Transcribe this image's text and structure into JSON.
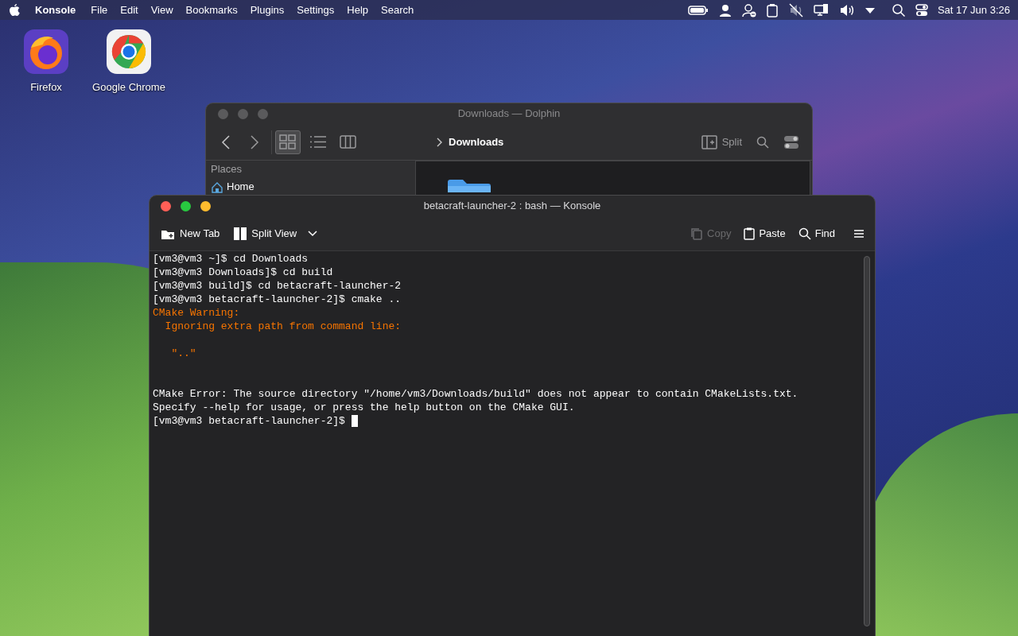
{
  "menubar": {
    "app": "Konsole",
    "menus": [
      "File",
      "Edit",
      "View",
      "Bookmarks",
      "Plugins",
      "Settings",
      "Help",
      "Search"
    ],
    "clock": "Sat 17 Jun 3:26"
  },
  "desktop_icons": [
    {
      "label": "Firefox",
      "kind": "firefox"
    },
    {
      "label": "Google Chrome",
      "kind": "chrome"
    }
  ],
  "dolphin": {
    "title": "Downloads — Dolphin",
    "breadcrumb": "Downloads",
    "split": "Split",
    "places_heading": "Places",
    "places": [
      "Home"
    ],
    "views": [
      {
        "kind": "icons",
        "selected": true
      },
      {
        "kind": "details",
        "selected": false
      },
      {
        "kind": "columns",
        "selected": false
      }
    ]
  },
  "konsole": {
    "title": "betacraft-launcher-2 : bash — Konsole",
    "toolbar_left": [
      {
        "label": "New Tab",
        "kind": "newtab"
      },
      {
        "label": "Split View",
        "kind": "split"
      }
    ],
    "toolbar_right": [
      {
        "label": "Copy",
        "kind": "copy",
        "disabled": true
      },
      {
        "label": "Paste",
        "kind": "paste",
        "disabled": false
      },
      {
        "label": "Find",
        "kind": "find",
        "disabled": false
      }
    ],
    "lines": [
      {
        "kind": "normal",
        "text": "[vm3@vm3 ~]$ cd Downloads"
      },
      {
        "kind": "normal",
        "text": "[vm3@vm3 Downloads]$ cd build"
      },
      {
        "kind": "normal",
        "text": "[vm3@vm3 build]$ cd betacraft-launcher-2"
      },
      {
        "kind": "normal",
        "text": "[vm3@vm3 betacraft-launcher-2]$ cmake .."
      },
      {
        "kind": "warning",
        "text": "CMake Warning:"
      },
      {
        "kind": "warning",
        "text": "  Ignoring extra path from command line:"
      },
      {
        "kind": "blank"
      },
      {
        "kind": "warning",
        "text": "   \"..\""
      },
      {
        "kind": "blank"
      },
      {
        "kind": "blank"
      },
      {
        "kind": "normal",
        "text": "CMake Error: The source directory \"/home/vm3/Downloads/build\" does not appear to contain CMakeLists.txt."
      },
      {
        "kind": "normal",
        "text": "Specify --help for usage, or press the help button on the CMake GUI."
      },
      {
        "kind": "prompt",
        "text": "[vm3@vm3 betacraft-launcher-2]$ "
      }
    ]
  }
}
